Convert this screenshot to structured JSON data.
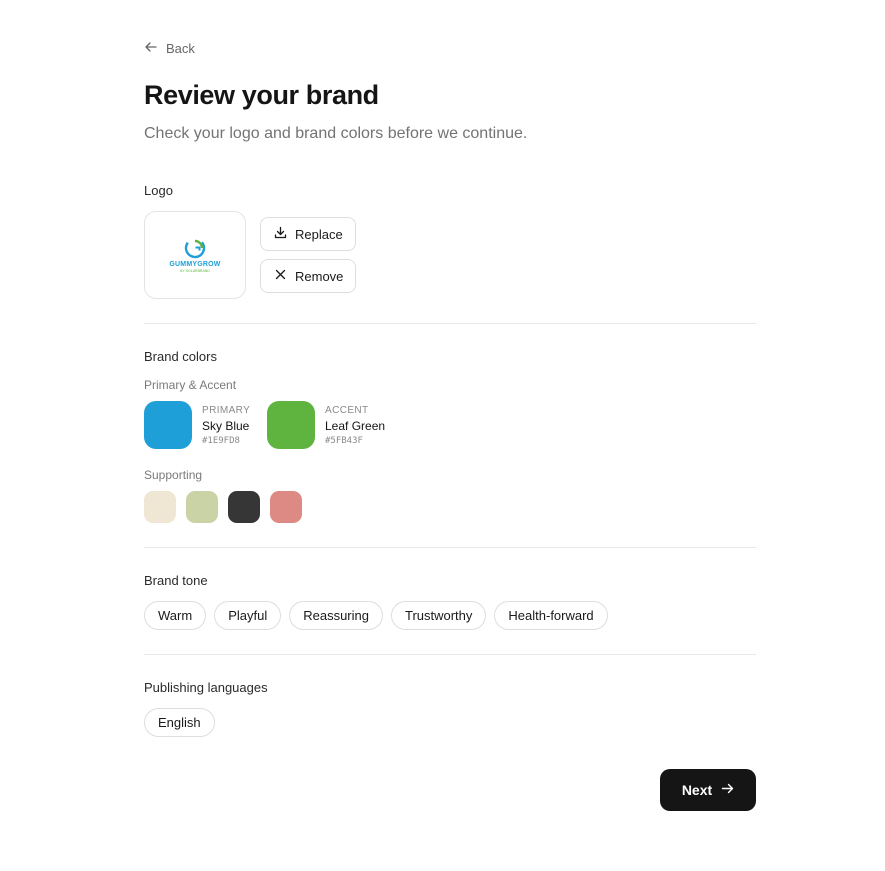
{
  "nav": {
    "back_label": "Back"
  },
  "header": {
    "title": "Review your brand",
    "subtitle": "Check your logo and brand colors before we continue."
  },
  "logo": {
    "section_label": "Logo",
    "wordmark": "GUMMYGROW",
    "tagline": "BY SOLARBRAND",
    "replace_label": "Replace",
    "remove_label": "Remove"
  },
  "colors": {
    "section_label": "Brand colors",
    "primary_accent_label": "Primary & Accent",
    "primary": {
      "role": "PRIMARY",
      "name": "Sky Blue",
      "hex": "#1E9FD8"
    },
    "accent": {
      "role": "ACCENT",
      "name": "Leaf Green",
      "hex": "#5FB43F"
    },
    "supporting_label": "Supporting",
    "supporting": [
      "#EFE6D4",
      "#C9D3A6",
      "#363636",
      "#DD8A84"
    ]
  },
  "tone": {
    "section_label": "Brand tone",
    "chips": [
      "Warm",
      "Playful",
      "Reassuring",
      "Trustworthy",
      "Health-forward"
    ]
  },
  "languages": {
    "section_label": "Publishing languages",
    "chips": [
      "English"
    ]
  },
  "footer": {
    "next_label": "Next"
  }
}
